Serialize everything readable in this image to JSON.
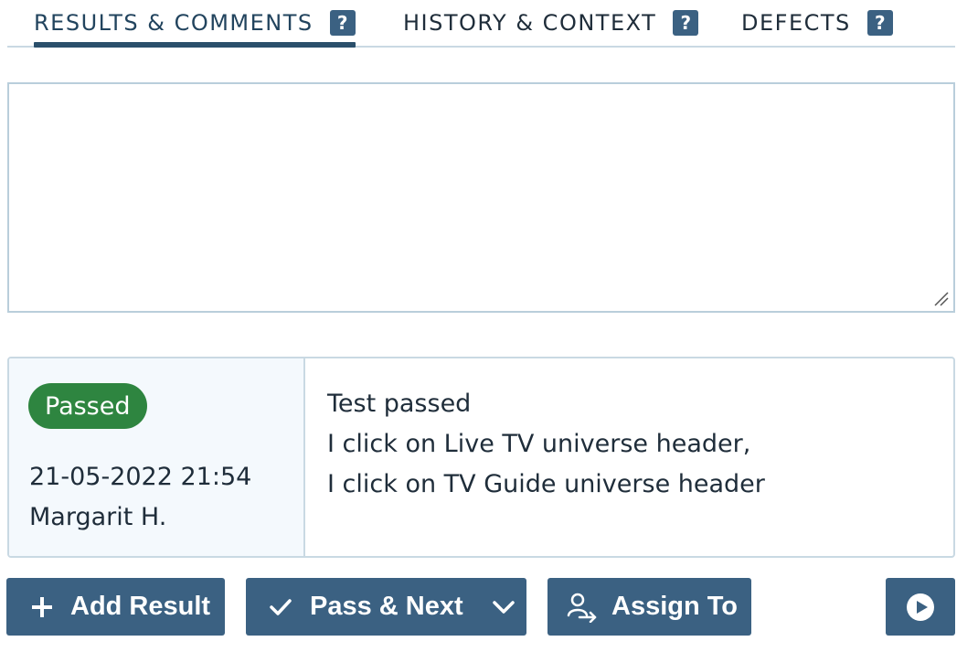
{
  "tabs": [
    {
      "label": "RESULTS & COMMENTS",
      "help": "?",
      "active": true
    },
    {
      "label": "HISTORY & CONTEXT",
      "help": "?",
      "active": false
    },
    {
      "label": "DEFECTS",
      "help": "?",
      "active": false
    }
  ],
  "comment_input": {
    "value": "",
    "placeholder": ""
  },
  "result": {
    "status": "Passed",
    "status_color": "#2e8540",
    "date": "21-05-2022 21:54",
    "user": "Margarit H.",
    "comment_lines": [
      "Test passed",
      "I click on Live TV universe header,",
      "I click on TV Guide universe header"
    ]
  },
  "actions": {
    "add_result": "Add Result",
    "pass_next": "Pass & Next",
    "assign_to": "Assign To",
    "play_icon": "play-circle-icon"
  },
  "colors": {
    "button_bg": "#3b6182",
    "border": "#c9d9e3",
    "accent": "#2a4f6b"
  }
}
